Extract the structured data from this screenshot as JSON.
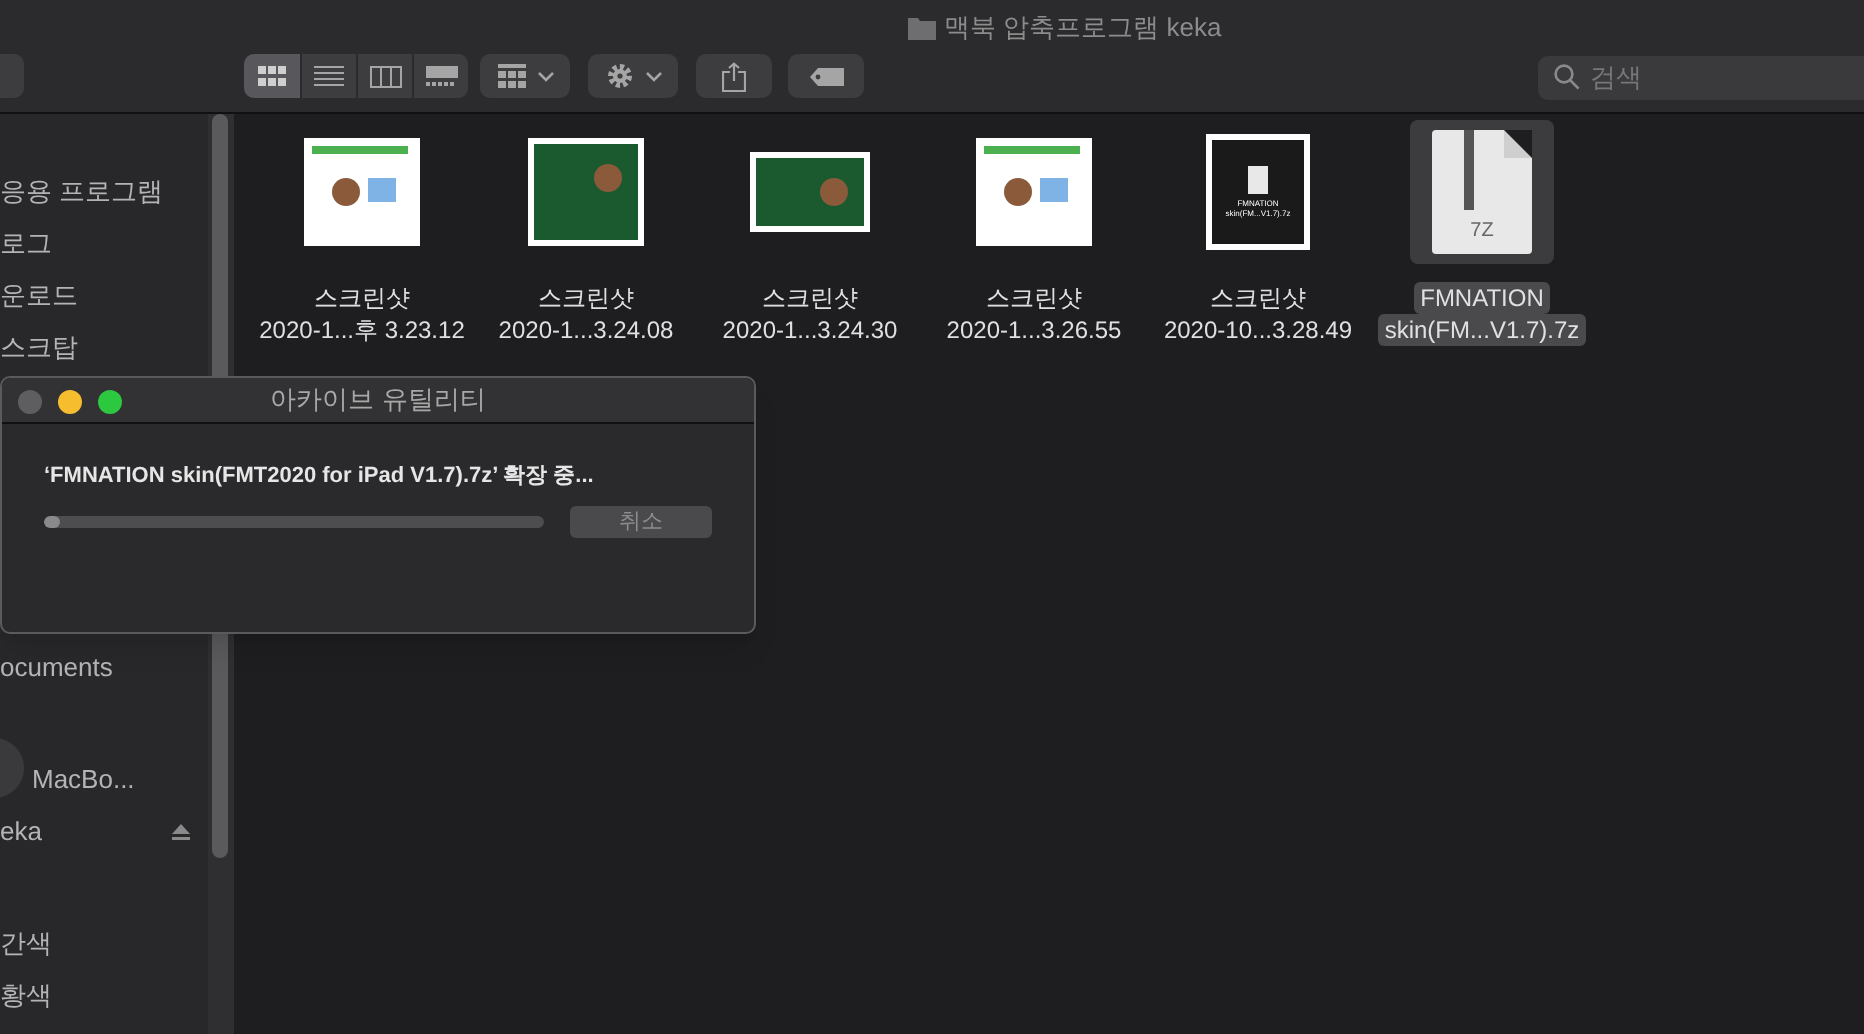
{
  "window": {
    "title": "맥북 압축프로그램 keka"
  },
  "toolbar": {
    "view_modes": [
      {
        "kind": "icons",
        "selected": true
      },
      {
        "kind": "list",
        "selected": false
      },
      {
        "kind": "columns",
        "selected": false
      },
      {
        "kind": "gallery",
        "selected": false
      }
    ]
  },
  "search": {
    "placeholder": "검색"
  },
  "sidebar": {
    "sections": [
      {
        "items": [
          {
            "label": "응용 프로그램"
          },
          {
            "label": "로그"
          },
          {
            "label": "운로드"
          },
          {
            "label": "스크탑"
          }
        ]
      },
      {
        "items": [
          {
            "label": "ocuments"
          }
        ]
      },
      {
        "items": [
          {
            "label": "MacBo...",
            "kind": "computer"
          },
          {
            "label": "eka",
            "kind": "disk"
          }
        ]
      },
      {
        "items": [
          {
            "label": "간색"
          },
          {
            "label": "황색"
          }
        ]
      }
    ]
  },
  "files": [
    {
      "name": "스크린샷",
      "detail": "2020-1...후 3.23.12",
      "kind": "light",
      "selected": false
    },
    {
      "name": "스크린샷",
      "detail": "2020-1...3.24.08",
      "kind": "dark",
      "selected": false
    },
    {
      "name": "스크린샷",
      "detail": "2020-1...3.24.30",
      "kind": "green",
      "selected": false
    },
    {
      "name": "스크린샷",
      "detail": "2020-1...3.26.55",
      "kind": "light",
      "selected": false
    },
    {
      "name": "스크린샷",
      "detail": "2020-10...3.28.49",
      "kind": "archive-shot",
      "selected": false,
      "caption": "FMNATION skin(FM...V1.7).7z"
    },
    {
      "name": "FMNATION",
      "detail": "skin(FM...V1.7).7z",
      "kind": "archive",
      "selected": true,
      "badge": "7Z"
    }
  ],
  "dialog": {
    "title": "아카이브 유틸리티",
    "message": "‘FMNATION skin(FMT2020 for iPad V1.7).7z’ 확장 중...",
    "button": "취소",
    "level": 0.03
  }
}
